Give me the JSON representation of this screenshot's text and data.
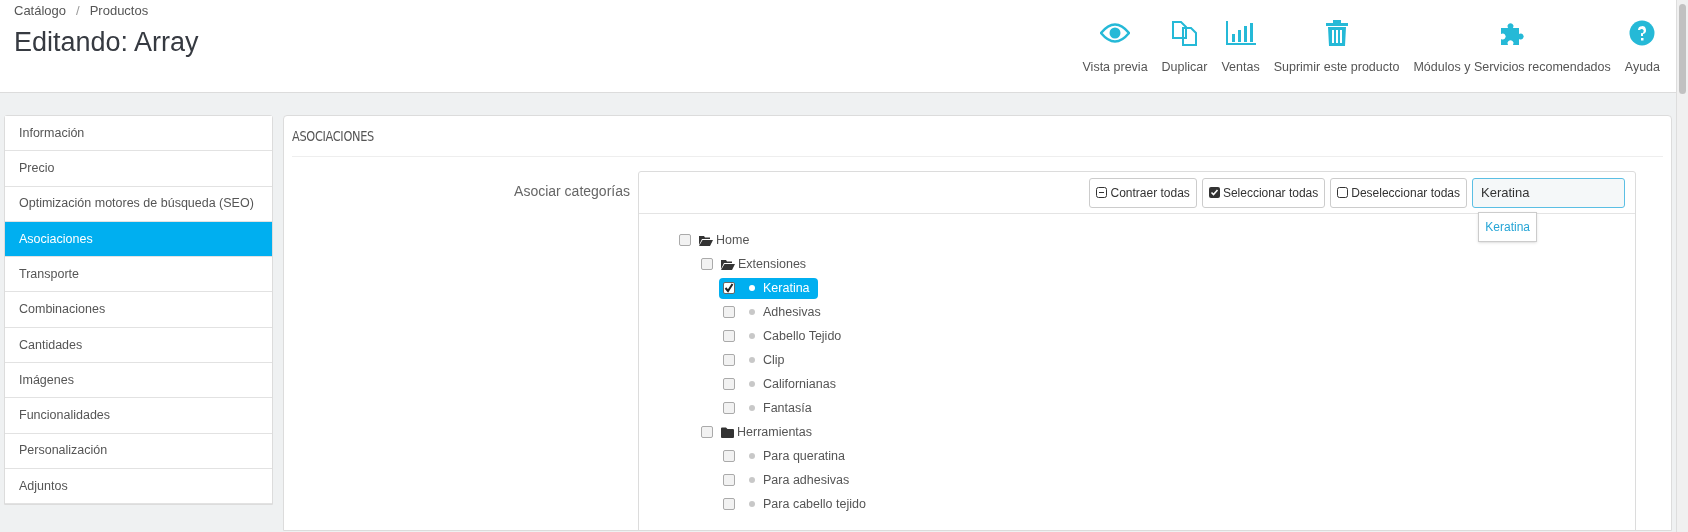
{
  "breadcrumb": {
    "items": [
      "Catálogo",
      "Productos"
    ],
    "separator": "/"
  },
  "title": "Editando: Array",
  "actions": [
    {
      "label": "Vista previa",
      "kind": "eye"
    },
    {
      "label": "Duplicar",
      "kind": "copy"
    },
    {
      "label": "Ventas",
      "kind": "chart"
    },
    {
      "label": "Suprimir este producto",
      "kind": "trash"
    },
    {
      "label": "Módulos y Servicios recomendados",
      "kind": "puzzle"
    },
    {
      "label": "Ayuda",
      "kind": "help"
    }
  ],
  "sidebar": {
    "items": [
      {
        "label": "Información",
        "selected": false
      },
      {
        "label": "Precio",
        "selected": false
      },
      {
        "label": "Optimización motores de búsqueda (SEO)",
        "selected": false
      },
      {
        "label": "Asociaciones",
        "selected": true
      },
      {
        "label": "Transporte",
        "selected": false
      },
      {
        "label": "Combinaciones",
        "selected": false
      },
      {
        "label": "Cantidades",
        "selected": false
      },
      {
        "label": "Imágenes",
        "selected": false
      },
      {
        "label": "Funcionalidades",
        "selected": false
      },
      {
        "label": "Personalización",
        "selected": false
      },
      {
        "label": "Adjuntos",
        "selected": false
      }
    ]
  },
  "panel": {
    "title": "ASOCIACIONES",
    "field_label": "Asociar categorías",
    "toolbar": [
      {
        "label": "Contraer todas",
        "kind": "collapse"
      },
      {
        "label": "Seleccionar todas",
        "kind": "check"
      },
      {
        "label": "Deseleccionar todas",
        "kind": "uncheck"
      }
    ],
    "search": {
      "value": "Keratina"
    },
    "suggestions": [
      "Keratina"
    ],
    "tree": [
      {
        "label": "Home",
        "kind": "open_folder",
        "checked": false,
        "selected": false,
        "children": [
          {
            "label": "Extensiones",
            "kind": "open_folder",
            "checked": false,
            "selected": false,
            "children": [
              {
                "label": "Keratina",
                "kind": "leaf",
                "checked": true,
                "selected": true
              },
              {
                "label": "Adhesivas",
                "kind": "leaf",
                "checked": false,
                "selected": false
              },
              {
                "label": "Cabello Tejido",
                "kind": "leaf",
                "checked": false,
                "selected": false
              },
              {
                "label": "Clip",
                "kind": "leaf",
                "checked": false,
                "selected": false
              },
              {
                "label": "Californianas",
                "kind": "leaf",
                "checked": false,
                "selected": false
              },
              {
                "label": "Fantasía",
                "kind": "leaf",
                "checked": false,
                "selected": false
              }
            ]
          },
          {
            "label": "Herramientas",
            "kind": "folder",
            "checked": false,
            "selected": false,
            "children": [
              {
                "label": "Para queratina",
                "kind": "leaf",
                "checked": false,
                "selected": false
              },
              {
                "label": "Para adhesivas",
                "kind": "leaf",
                "checked": false,
                "selected": false
              },
              {
                "label": "Para cabello tejido",
                "kind": "leaf",
                "checked": false,
                "selected": false
              }
            ]
          }
        ]
      }
    ]
  }
}
